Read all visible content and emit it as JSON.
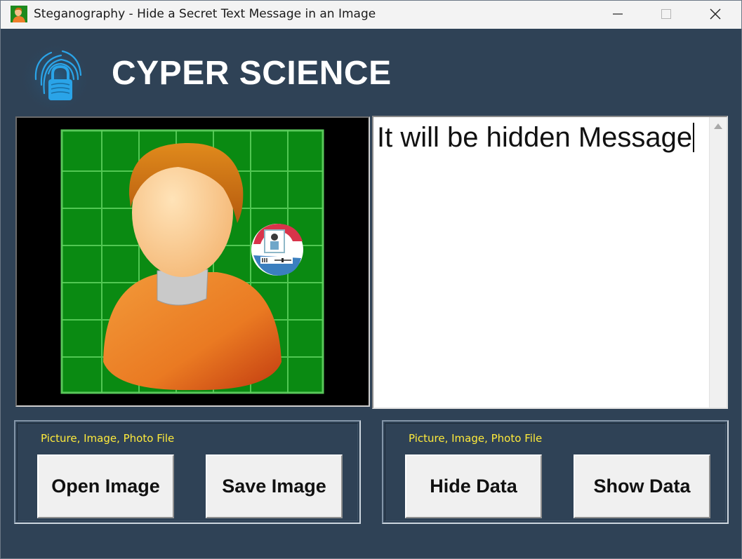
{
  "window": {
    "title": "Steganography - Hide a Secret Text Message in an Image",
    "controls": {
      "minimize_icon": "minimize-icon",
      "maximize_icon": "maximize-icon",
      "close_icon": "close-icon"
    }
  },
  "header": {
    "logo_icon": "fingerprint-lock-icon",
    "brand": "CYPER SCIENCE"
  },
  "image_panel": {
    "content": "user-avatar-illustration"
  },
  "message": {
    "text": "It will be hidden Message"
  },
  "image_group": {
    "label": "Picture, Image, Photo File",
    "open_label": "Open Image",
    "save_label": "Save Image"
  },
  "data_group": {
    "label": "Picture, Image, Photo File",
    "hide_label": "Hide Data",
    "show_label": "Show Data"
  },
  "colors": {
    "window_bg": "#2f4256",
    "group_label": "#ffeb3b",
    "button_bg": "#f0f0f0",
    "brand_text": "#ffffff"
  }
}
